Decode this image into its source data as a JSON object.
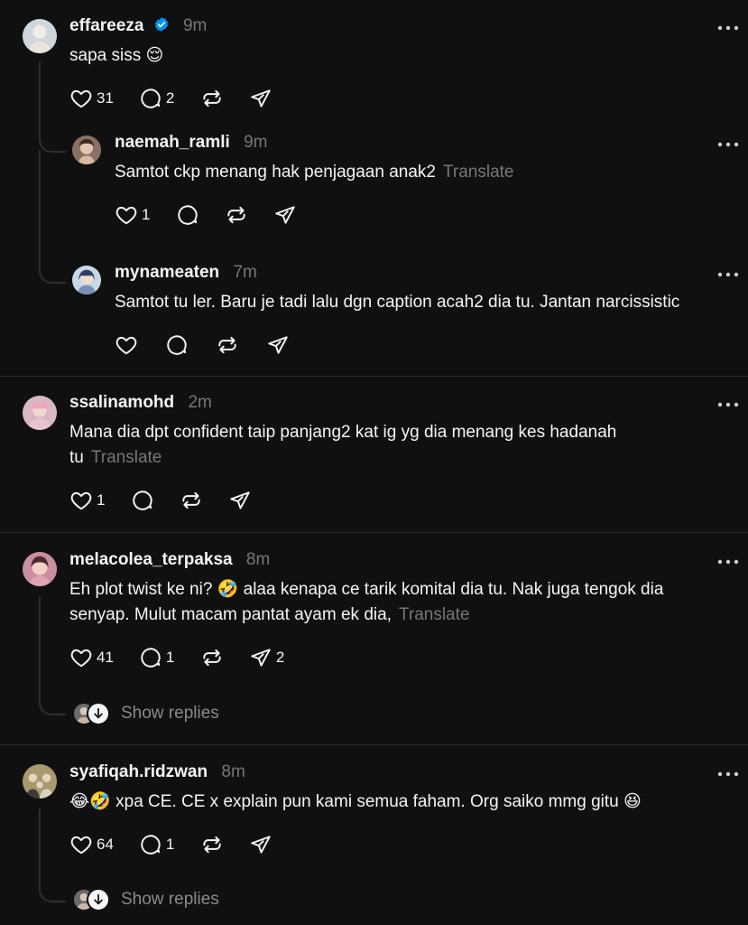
{
  "colors": {
    "background": "#101010",
    "text": "#f3f5f7",
    "muted": "#777777",
    "verified": "#0095f6"
  },
  "show_replies_label": "Show replies",
  "translate_label": "Translate",
  "posts": [
    {
      "username": "effareeza",
      "time": "9m",
      "verified": true,
      "text": "sapa siss 😌",
      "likes": "31",
      "comments": "2",
      "reposts": "",
      "shares": ""
    },
    {
      "username": "naemah_ramli",
      "time": "9m",
      "text": "Samtot ckp menang hak penjagaan anak2",
      "likes": "1",
      "comments": "",
      "reposts": "",
      "shares": ""
    },
    {
      "username": "mynameaten",
      "time": "7m",
      "text": "Samtot tu ler. Baru je tadi lalu dgn caption acah2 dia tu. Jantan narcissistic",
      "likes": "",
      "comments": "",
      "reposts": "",
      "shares": ""
    },
    {
      "username": "ssalinamohd",
      "time": "2m",
      "text_line1": "Mana dia dpt confident taip panjang2 kat ig yg dia menang kes hadanah",
      "text_line2": "tu",
      "likes": "1",
      "comments": "",
      "reposts": "",
      "shares": ""
    },
    {
      "username": "melacolea_terpaksa",
      "time": "8m",
      "text_line1": "Eh plot twist ke ni? 🤣 alaa kenapa ce tarik komital dia tu. Nak juga tengok dia",
      "text_line2": "senyap. Mulut macam pantat ayam ek dia,",
      "likes": "41",
      "comments": "1",
      "reposts": "",
      "shares": "2"
    },
    {
      "username": "syafiqah.ridzwan",
      "time": "8m",
      "text": "😂🤣 xpa CE. CE x explain pun kami semua faham. Org saiko mmg gitu 😆",
      "likes": "64",
      "comments": "1",
      "reposts": "",
      "shares": ""
    }
  ]
}
